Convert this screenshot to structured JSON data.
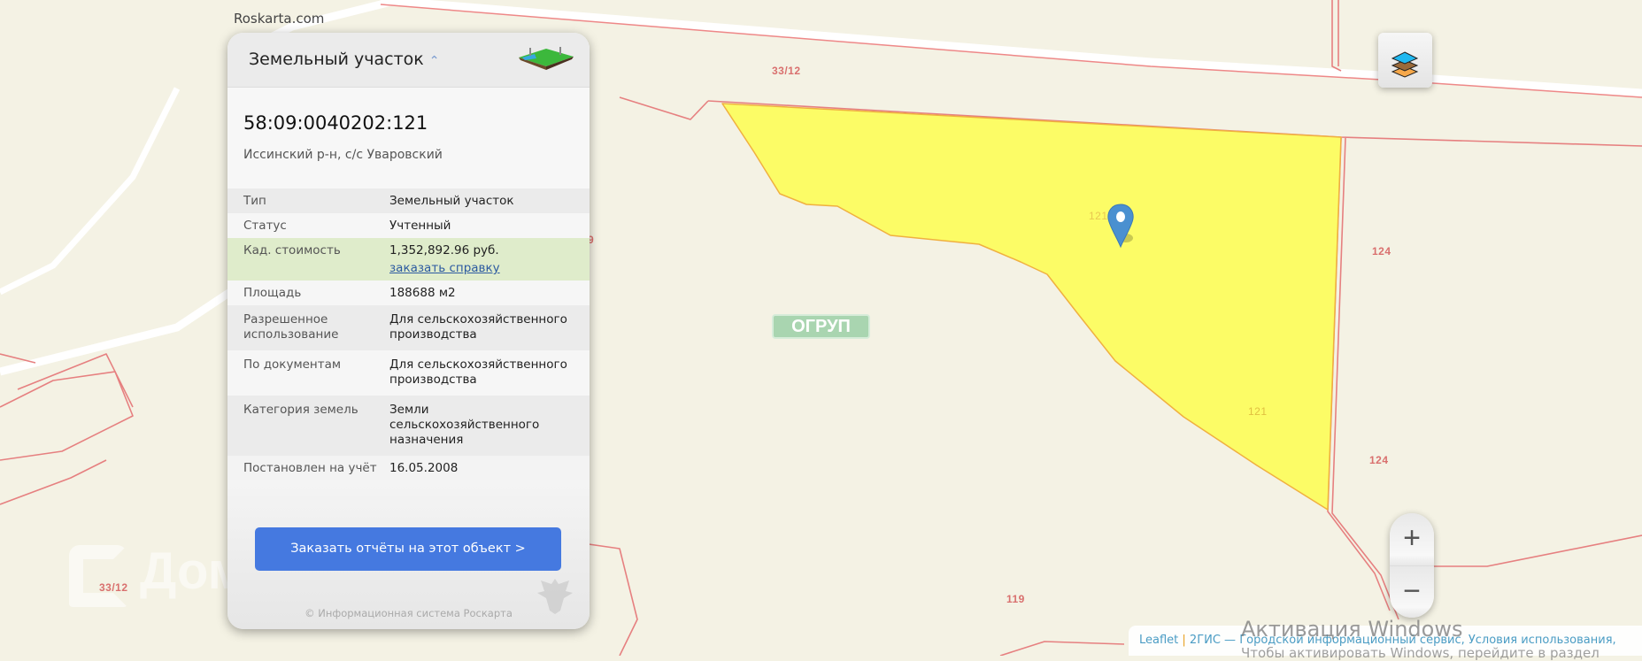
{
  "site": "Roskarta.com",
  "map": {
    "labels": [
      {
        "text": "33/12",
        "kind": "parcel"
      },
      {
        "text": "124",
        "kind": "parcel"
      },
      {
        "text": "121",
        "kind": "parcel"
      },
      {
        "text": "124",
        "kind": "parcel"
      },
      {
        "text": "119",
        "kind": "parcel"
      },
      {
        "text": "121",
        "kind": "selected"
      },
      {
        "text": "33/12",
        "kind": "parcel"
      },
      {
        "text": "9",
        "kind": "parcel"
      }
    ],
    "ogrup_logo": "ОГРУП",
    "domclick_watermark": "Домклик",
    "highlight_color": "#fcfc66",
    "boundary_color": "#e07b7b"
  },
  "panel": {
    "title": "Земельный участок",
    "cadastral_number": "58:09:0040202:121",
    "address": "Иссинский р-н, с/с Уваровский",
    "rows": [
      {
        "key": "Тип",
        "value": "Земельный участок"
      },
      {
        "key": "Статус",
        "value": "Учтенный"
      },
      {
        "key": "Кад. стоимость",
        "value": "1,352,892.96 руб.",
        "link": "заказать справку"
      },
      {
        "key": "Площадь",
        "value": "188688 м2"
      },
      {
        "key": "Разрешенное использование",
        "value": "Для сельскохозяйственного производства"
      },
      {
        "key": "По документам",
        "value": "Для сельскохозяйственного производства"
      },
      {
        "key": "Категория земель",
        "value": "Земли сельскохозяйственного назначения"
      },
      {
        "key": "Постановлен на учёт",
        "value": "16.05.2008"
      }
    ],
    "order_button": "Заказать отчёты на этот объект >",
    "footer": "© Информационная система Роскарта"
  },
  "controls": {
    "zoom_in": "+",
    "zoom_out": "−"
  },
  "attribution": {
    "leaflet": "Leaflet",
    "separator": " | ",
    "provider": "2ГИС — Городской информационный сервис, Условия использования,"
  },
  "windows_activation": {
    "title": "Активация Windows",
    "subtitle": "Чтобы активировать Windows, перейдите в раздел"
  }
}
